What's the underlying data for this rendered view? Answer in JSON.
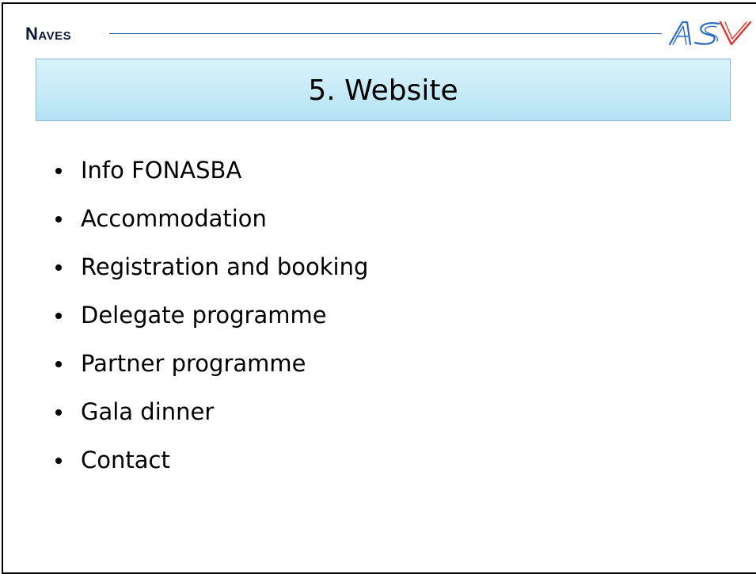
{
  "header": {
    "brand_initial": "N",
    "brand_rest": "AVES",
    "logo": "ASV-logo"
  },
  "slide": {
    "title": "5. Website",
    "bullets": [
      "Info FONASBA",
      "Accommodation",
      "Registration and booking",
      "Delegate programme",
      "Partner programme",
      "Gala dinner",
      "Contact"
    ]
  },
  "colors": {
    "brand_text": "#0c1a3a",
    "rule": "#1c5aa8",
    "title_bg_top": "#d9f3fb",
    "title_bg_bottom": "#b4e2f2",
    "logo_blue": "#2a6bc4",
    "logo_red": "#e0312b"
  }
}
